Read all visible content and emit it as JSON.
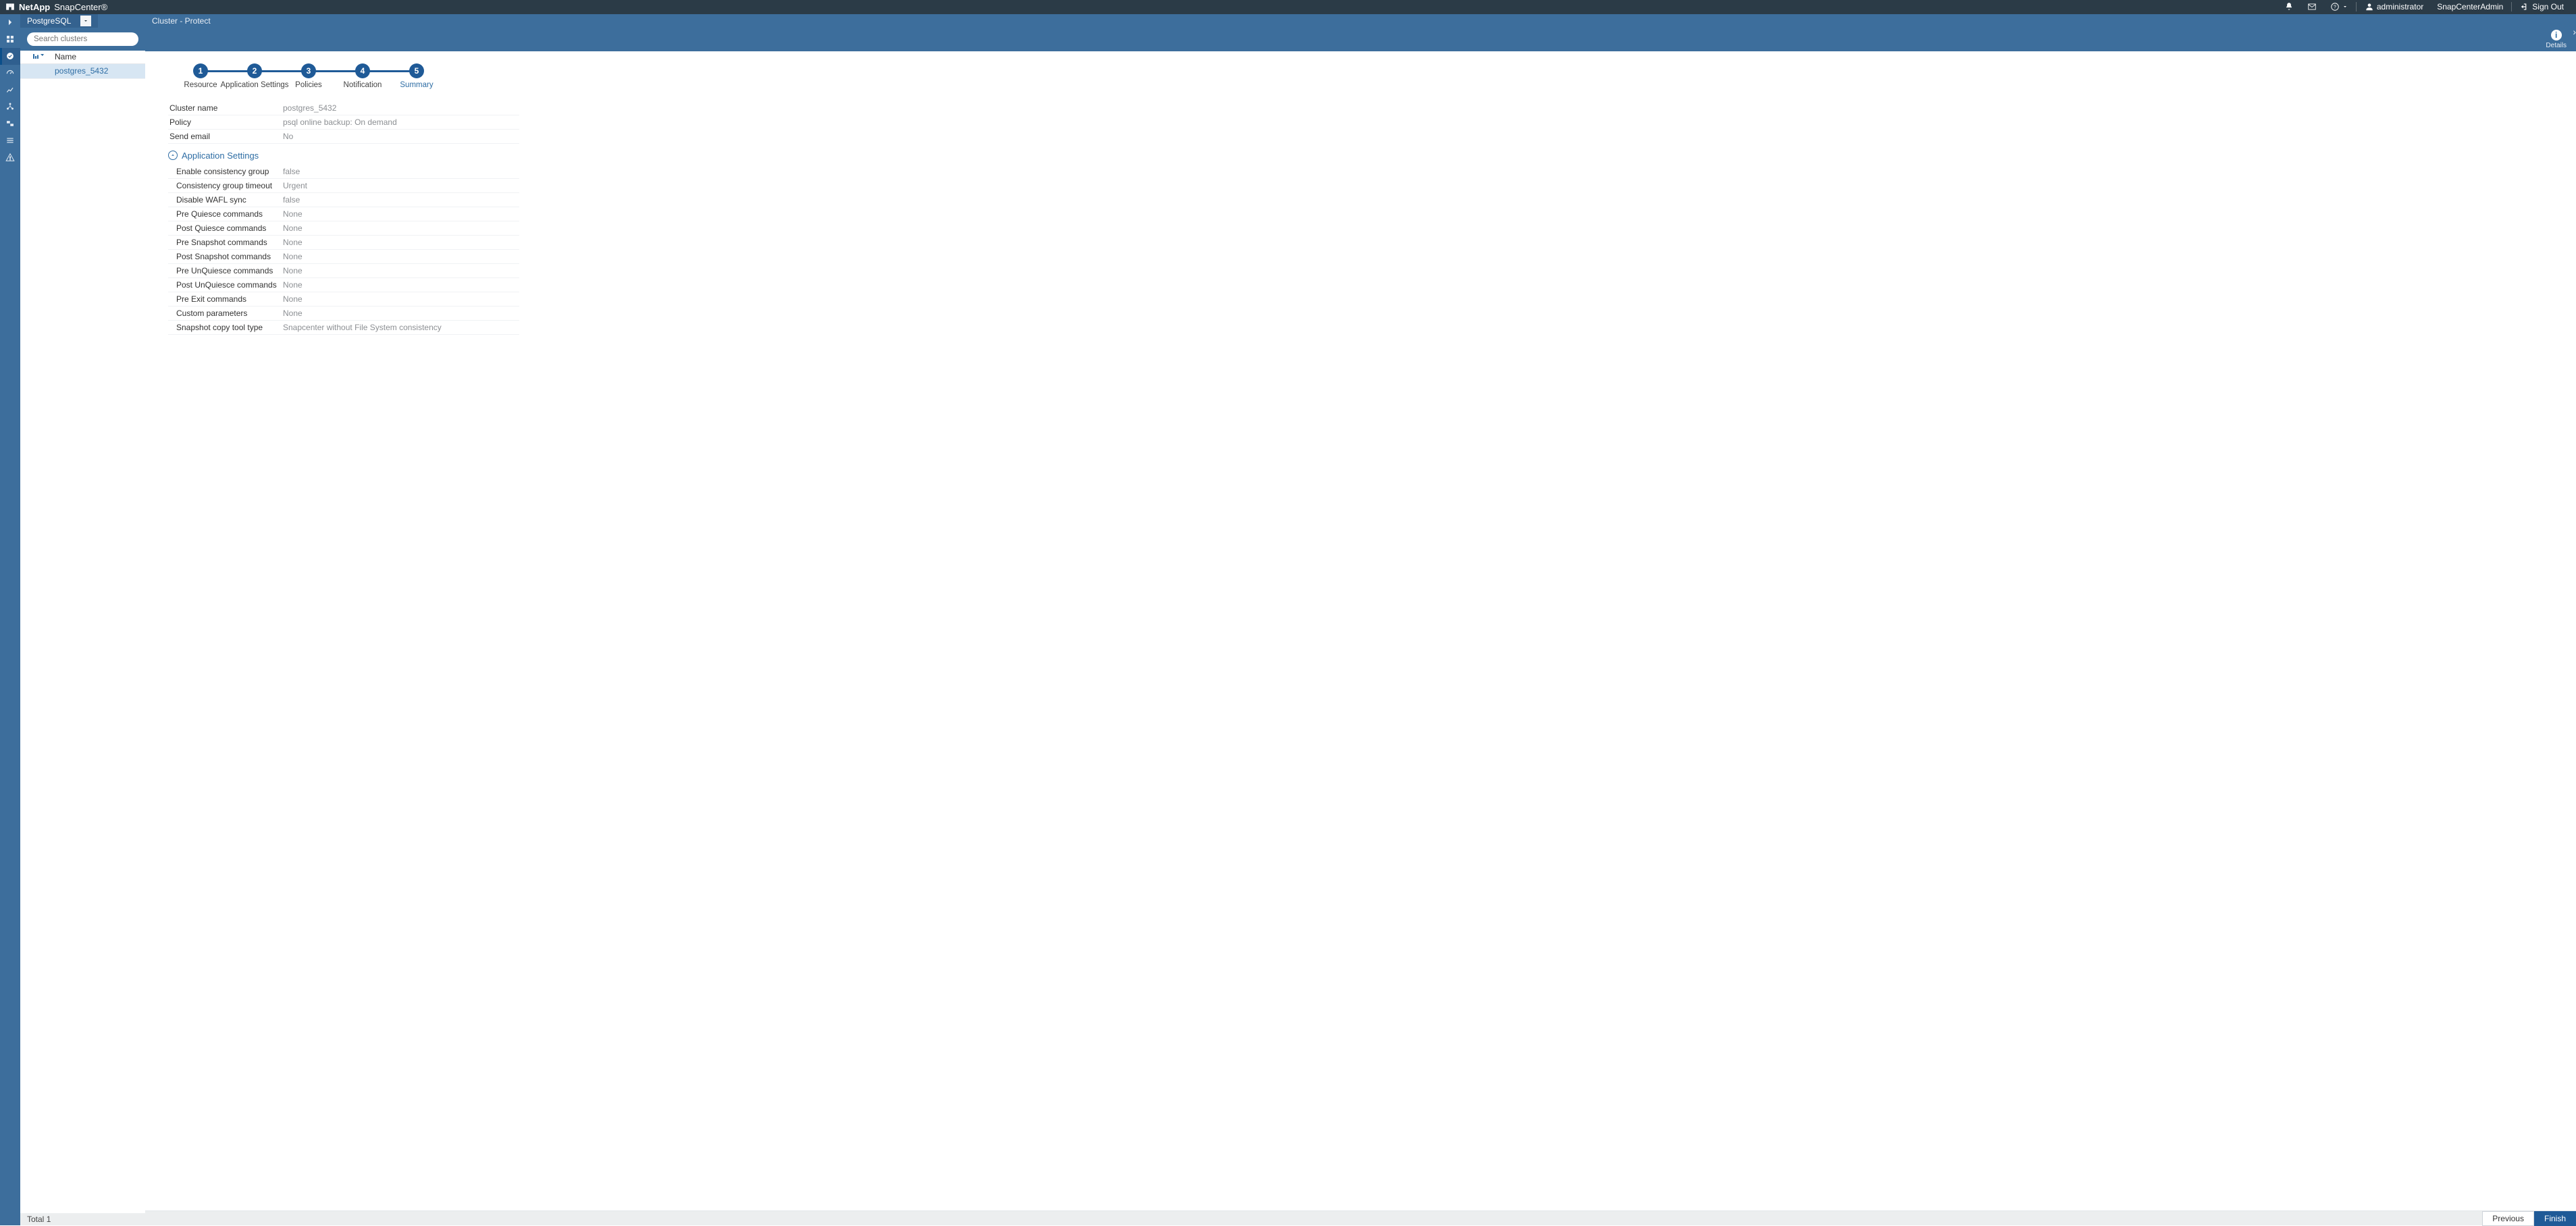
{
  "brand": {
    "vendor": "NetApp",
    "product": "SnapCenter®"
  },
  "topbar": {
    "help_label": "",
    "user": {
      "name": "administrator"
    },
    "role": "SnapCenterAdmin",
    "signout": "Sign Out"
  },
  "sidepanel": {
    "tab_label": "PostgreSQL",
    "search_placeholder": "Search clusters",
    "columns": {
      "name": "Name"
    },
    "rows": [
      {
        "name": "postgres_5432"
      }
    ],
    "footer_total_label": "Total",
    "footer_total": "1"
  },
  "breadcrumb": "Cluster - Protect",
  "details_label": "Details",
  "stepper": [
    {
      "n": "1",
      "label": "Resource"
    },
    {
      "n": "2",
      "label": "Application Settings"
    },
    {
      "n": "3",
      "label": "Policies"
    },
    {
      "n": "4",
      "label": "Notification"
    },
    {
      "n": "5",
      "label": "Summary"
    }
  ],
  "summary": {
    "top": [
      {
        "k": "Cluster name",
        "v": "postgres_5432"
      },
      {
        "k": "Policy",
        "v": "psql online backup: On demand"
      },
      {
        "k": "Send email",
        "v": "No"
      }
    ],
    "section": "Application Settings",
    "app": [
      {
        "k": "Enable consistency group",
        "v": "false"
      },
      {
        "k": "Consistency group timeout",
        "v": "Urgent"
      },
      {
        "k": "Disable WAFL sync",
        "v": "false"
      },
      {
        "k": "Pre Quiesce commands",
        "v": "None"
      },
      {
        "k": "Post Quiesce commands",
        "v": "None"
      },
      {
        "k": "Pre Snapshot commands",
        "v": "None"
      },
      {
        "k": "Post Snapshot commands",
        "v": "None"
      },
      {
        "k": "Pre UnQuiesce commands",
        "v": "None"
      },
      {
        "k": "Post UnQuiesce commands",
        "v": "None"
      },
      {
        "k": "Pre Exit commands",
        "v": "None"
      },
      {
        "k": "Custom parameters",
        "v": "None"
      },
      {
        "k": "Snapshot copy tool type",
        "v": "Snapcenter without File System consistency"
      }
    ]
  },
  "footer": {
    "previous": "Previous",
    "finish": "Finish"
  }
}
